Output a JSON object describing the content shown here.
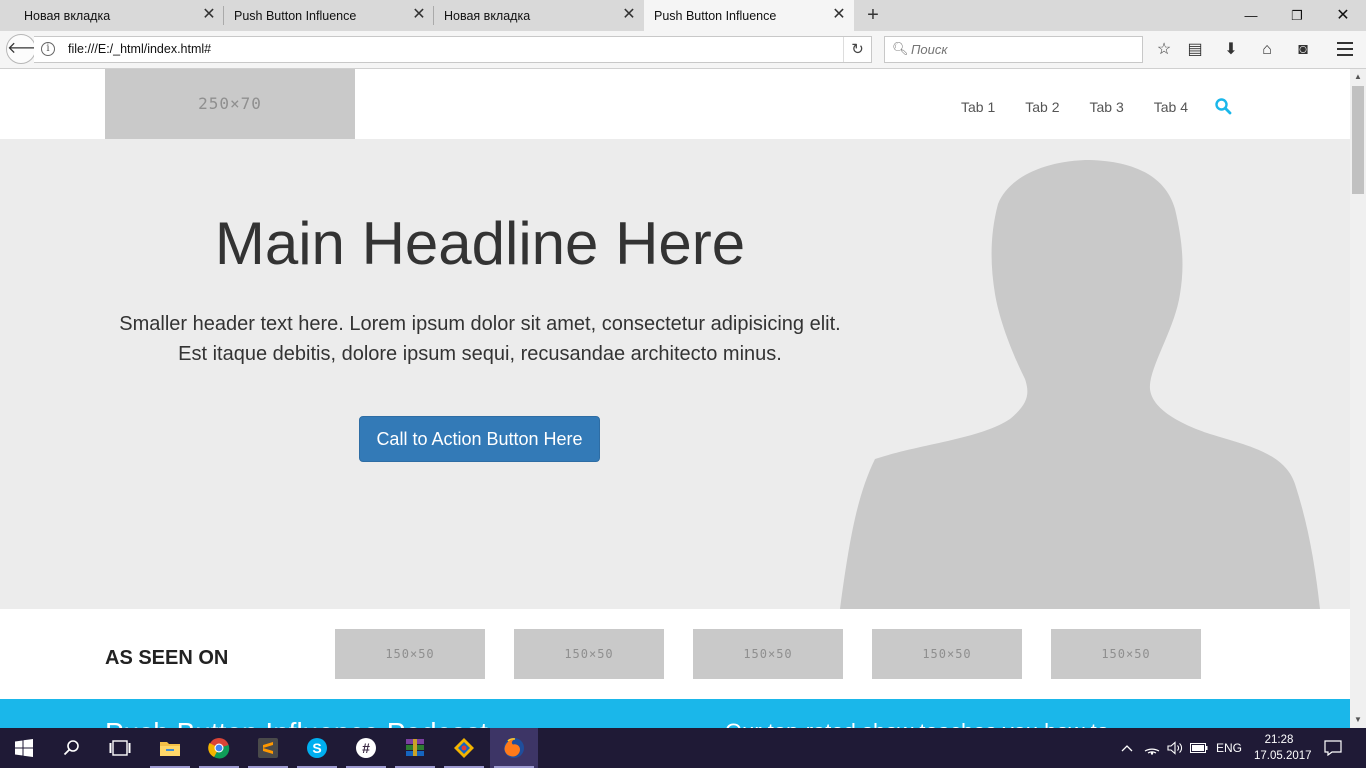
{
  "browser": {
    "tabs": [
      {
        "title": "Новая вкладка",
        "active": false
      },
      {
        "title": "Push Button Influence",
        "active": false
      },
      {
        "title": "Новая вкладка",
        "active": false
      },
      {
        "title": "Push Button Influence",
        "active": true
      }
    ],
    "url": "file:///E:/_html/index.html#",
    "search_placeholder": "Поиск"
  },
  "site": {
    "logo_placeholder": "250×70",
    "nav": [
      "Tab 1",
      "Tab 2",
      "Tab 3",
      "Tab 4"
    ],
    "accent_color": "#1ab7ea",
    "hero": {
      "headline": "Main Headline Here",
      "subheadline": "Smaller header text here. Lorem ipsum dolor sit amet, consectetur adipisicing elit. Est itaque debitis, dolore ipsum sequi, recusandae architecto minus.",
      "cta_label": "Call to Action Button Here"
    },
    "as_seen_on": {
      "title": "AS SEEN ON",
      "logos": [
        "150×50",
        "150×50",
        "150×50",
        "150×50",
        "150×50"
      ]
    },
    "band": {
      "left_text": "Push Button Influence Podcast",
      "right_text": "Our top-rated show teaches you how to"
    }
  },
  "taskbar": {
    "language": "ENG",
    "time": "21:28",
    "date": "17.05.2017"
  }
}
